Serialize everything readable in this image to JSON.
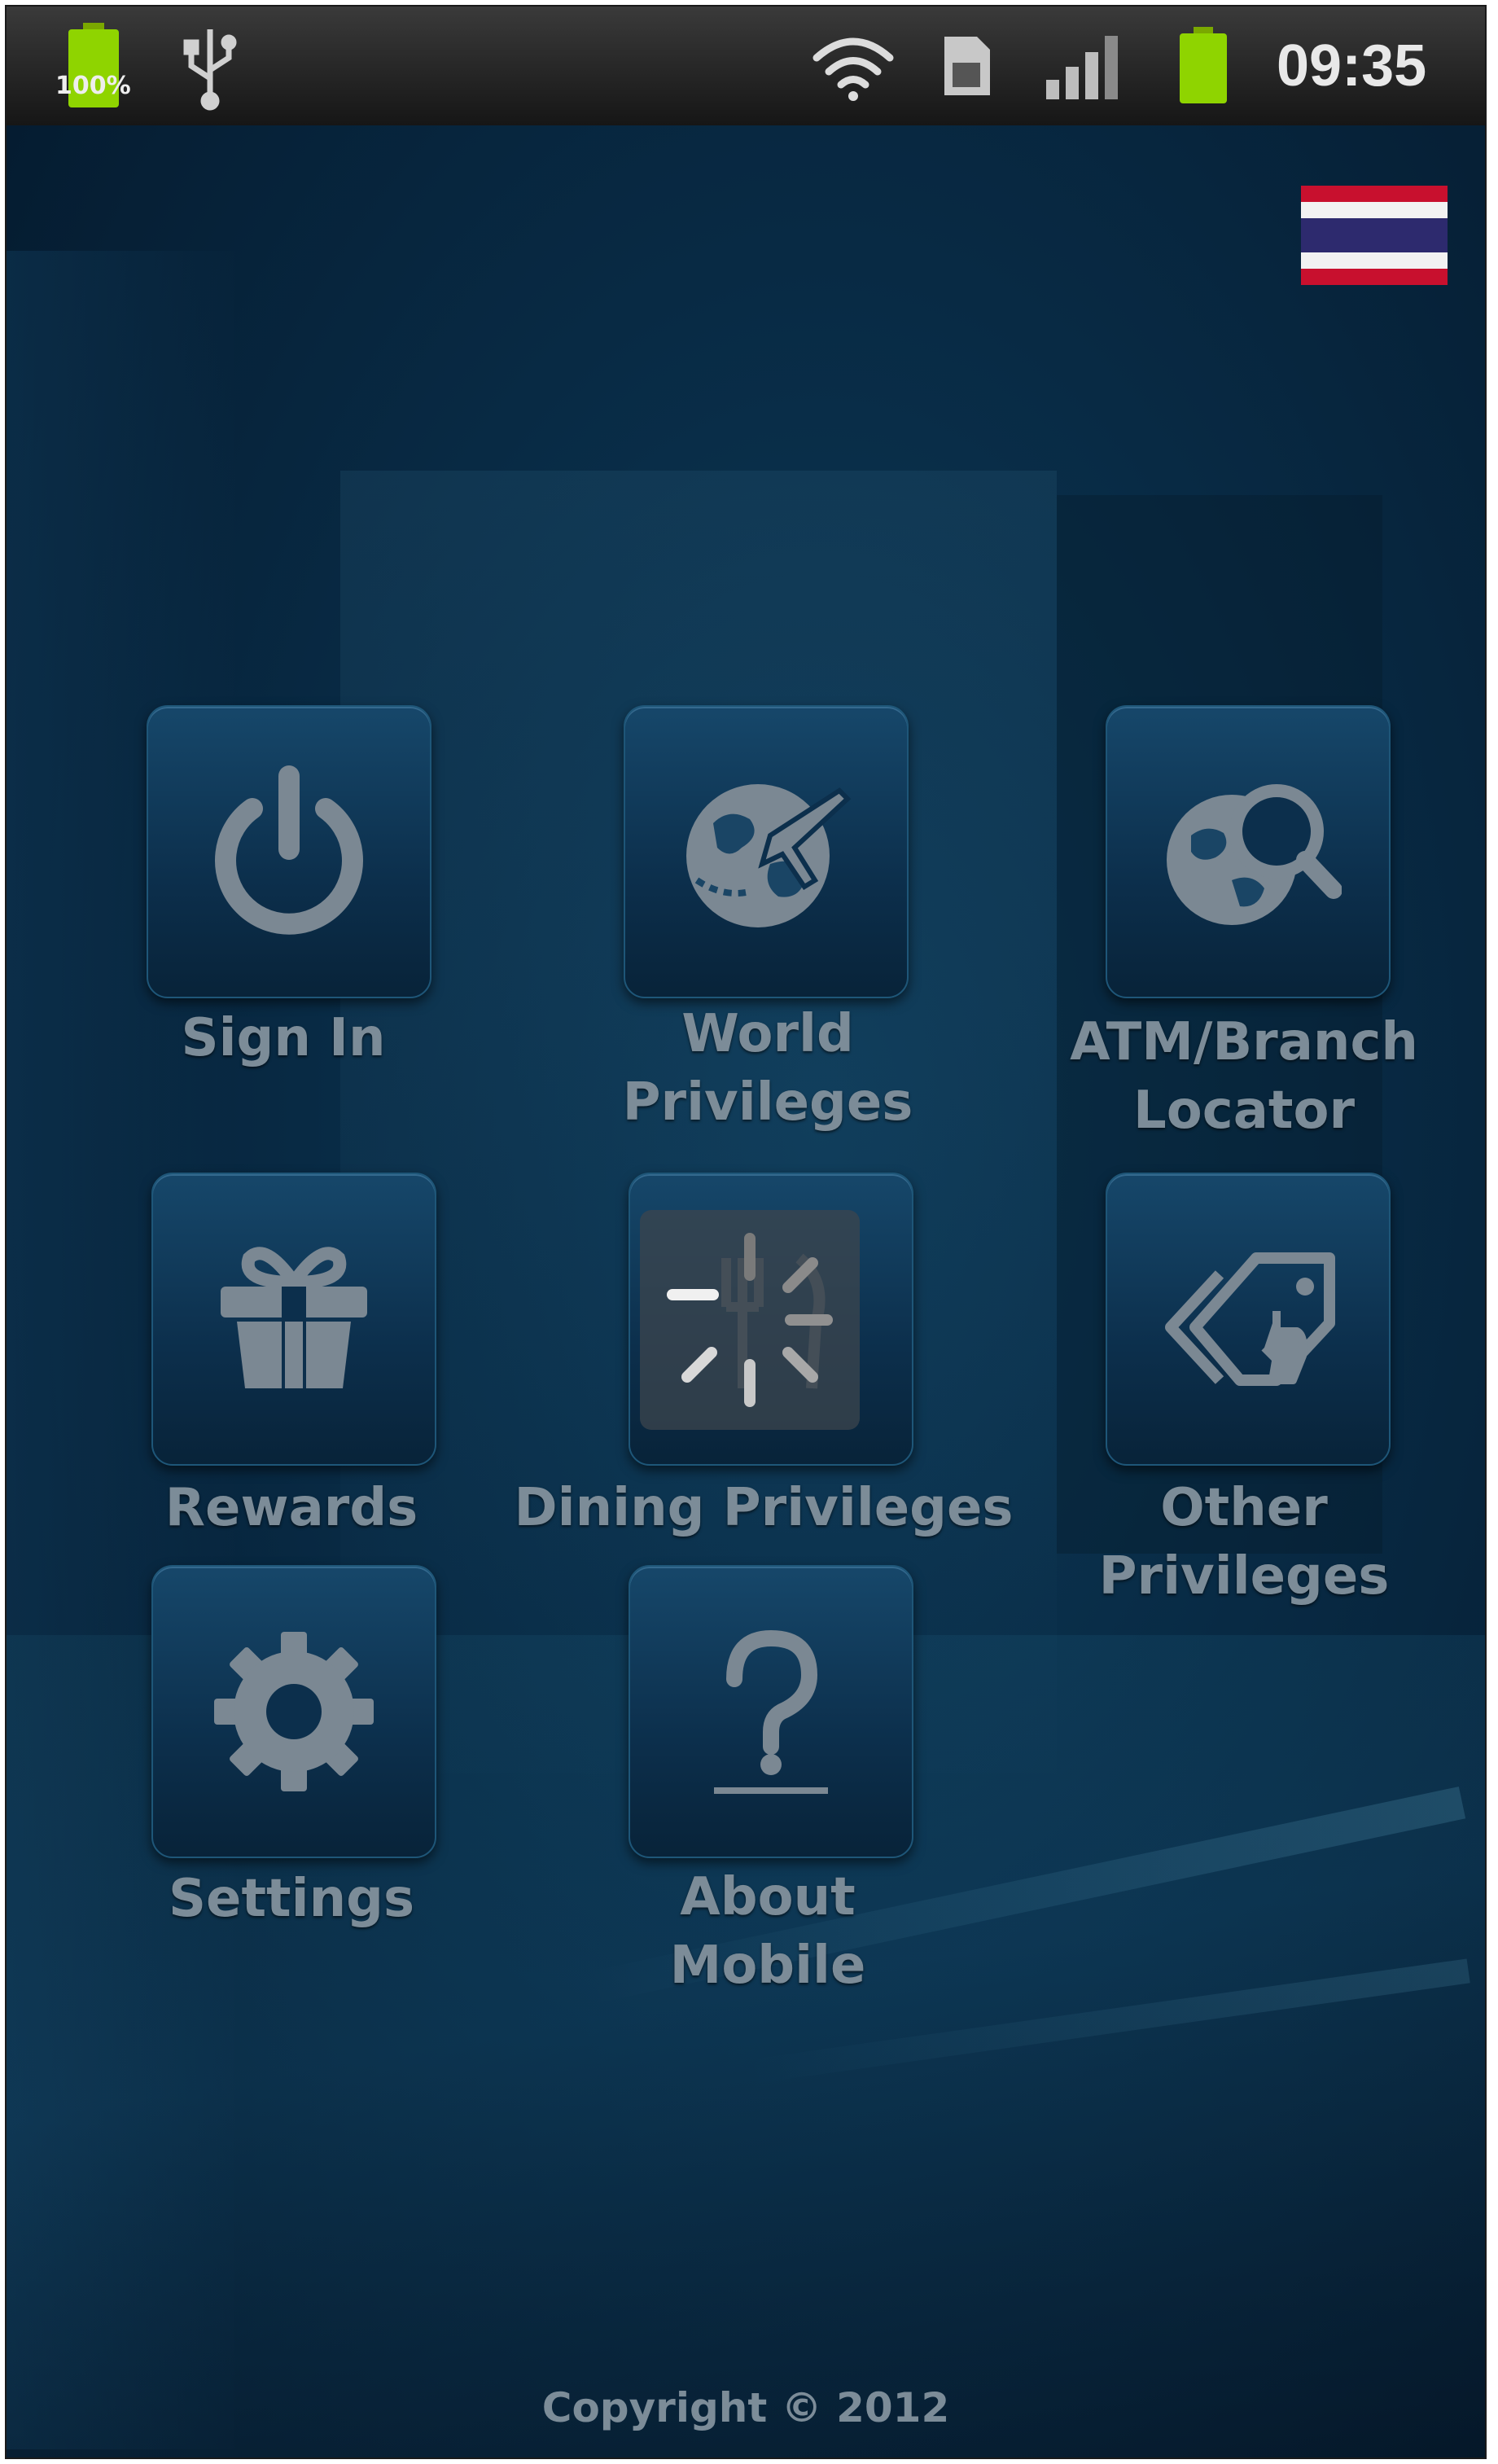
{
  "status_bar": {
    "battery_left_label": "100%",
    "time": "09:35",
    "icons": [
      "battery-icon",
      "usb-icon",
      "wifi-icon",
      "sim-icon",
      "signal-icon",
      "battery-icon"
    ]
  },
  "header": {
    "language_flag": "thai-flag-icon"
  },
  "menu": {
    "items": [
      {
        "label": "Sign In",
        "icon": "power-icon"
      },
      {
        "label": "World\nPrivileges",
        "icon": "globe-plane-icon"
      },
      {
        "label": "ATM/Branch\nLocator",
        "icon": "globe-search-icon"
      },
      {
        "label": "Rewards",
        "icon": "gift-icon"
      },
      {
        "label": "Dining Privileges",
        "icon": "dining-icon"
      },
      {
        "label": "Other Privileges",
        "icon": "tag-icon"
      },
      {
        "label": "Settings",
        "icon": "gear-icon"
      },
      {
        "label": "About\nMobile",
        "icon": "question-icon"
      }
    ]
  },
  "footer": {
    "copyright": "Copyright © 2012"
  },
  "colors": {
    "background": "#082a44",
    "tile": "#16476a",
    "icon": "#7b8893",
    "label": "#7c8c98",
    "battery_green": "#8fd400"
  }
}
